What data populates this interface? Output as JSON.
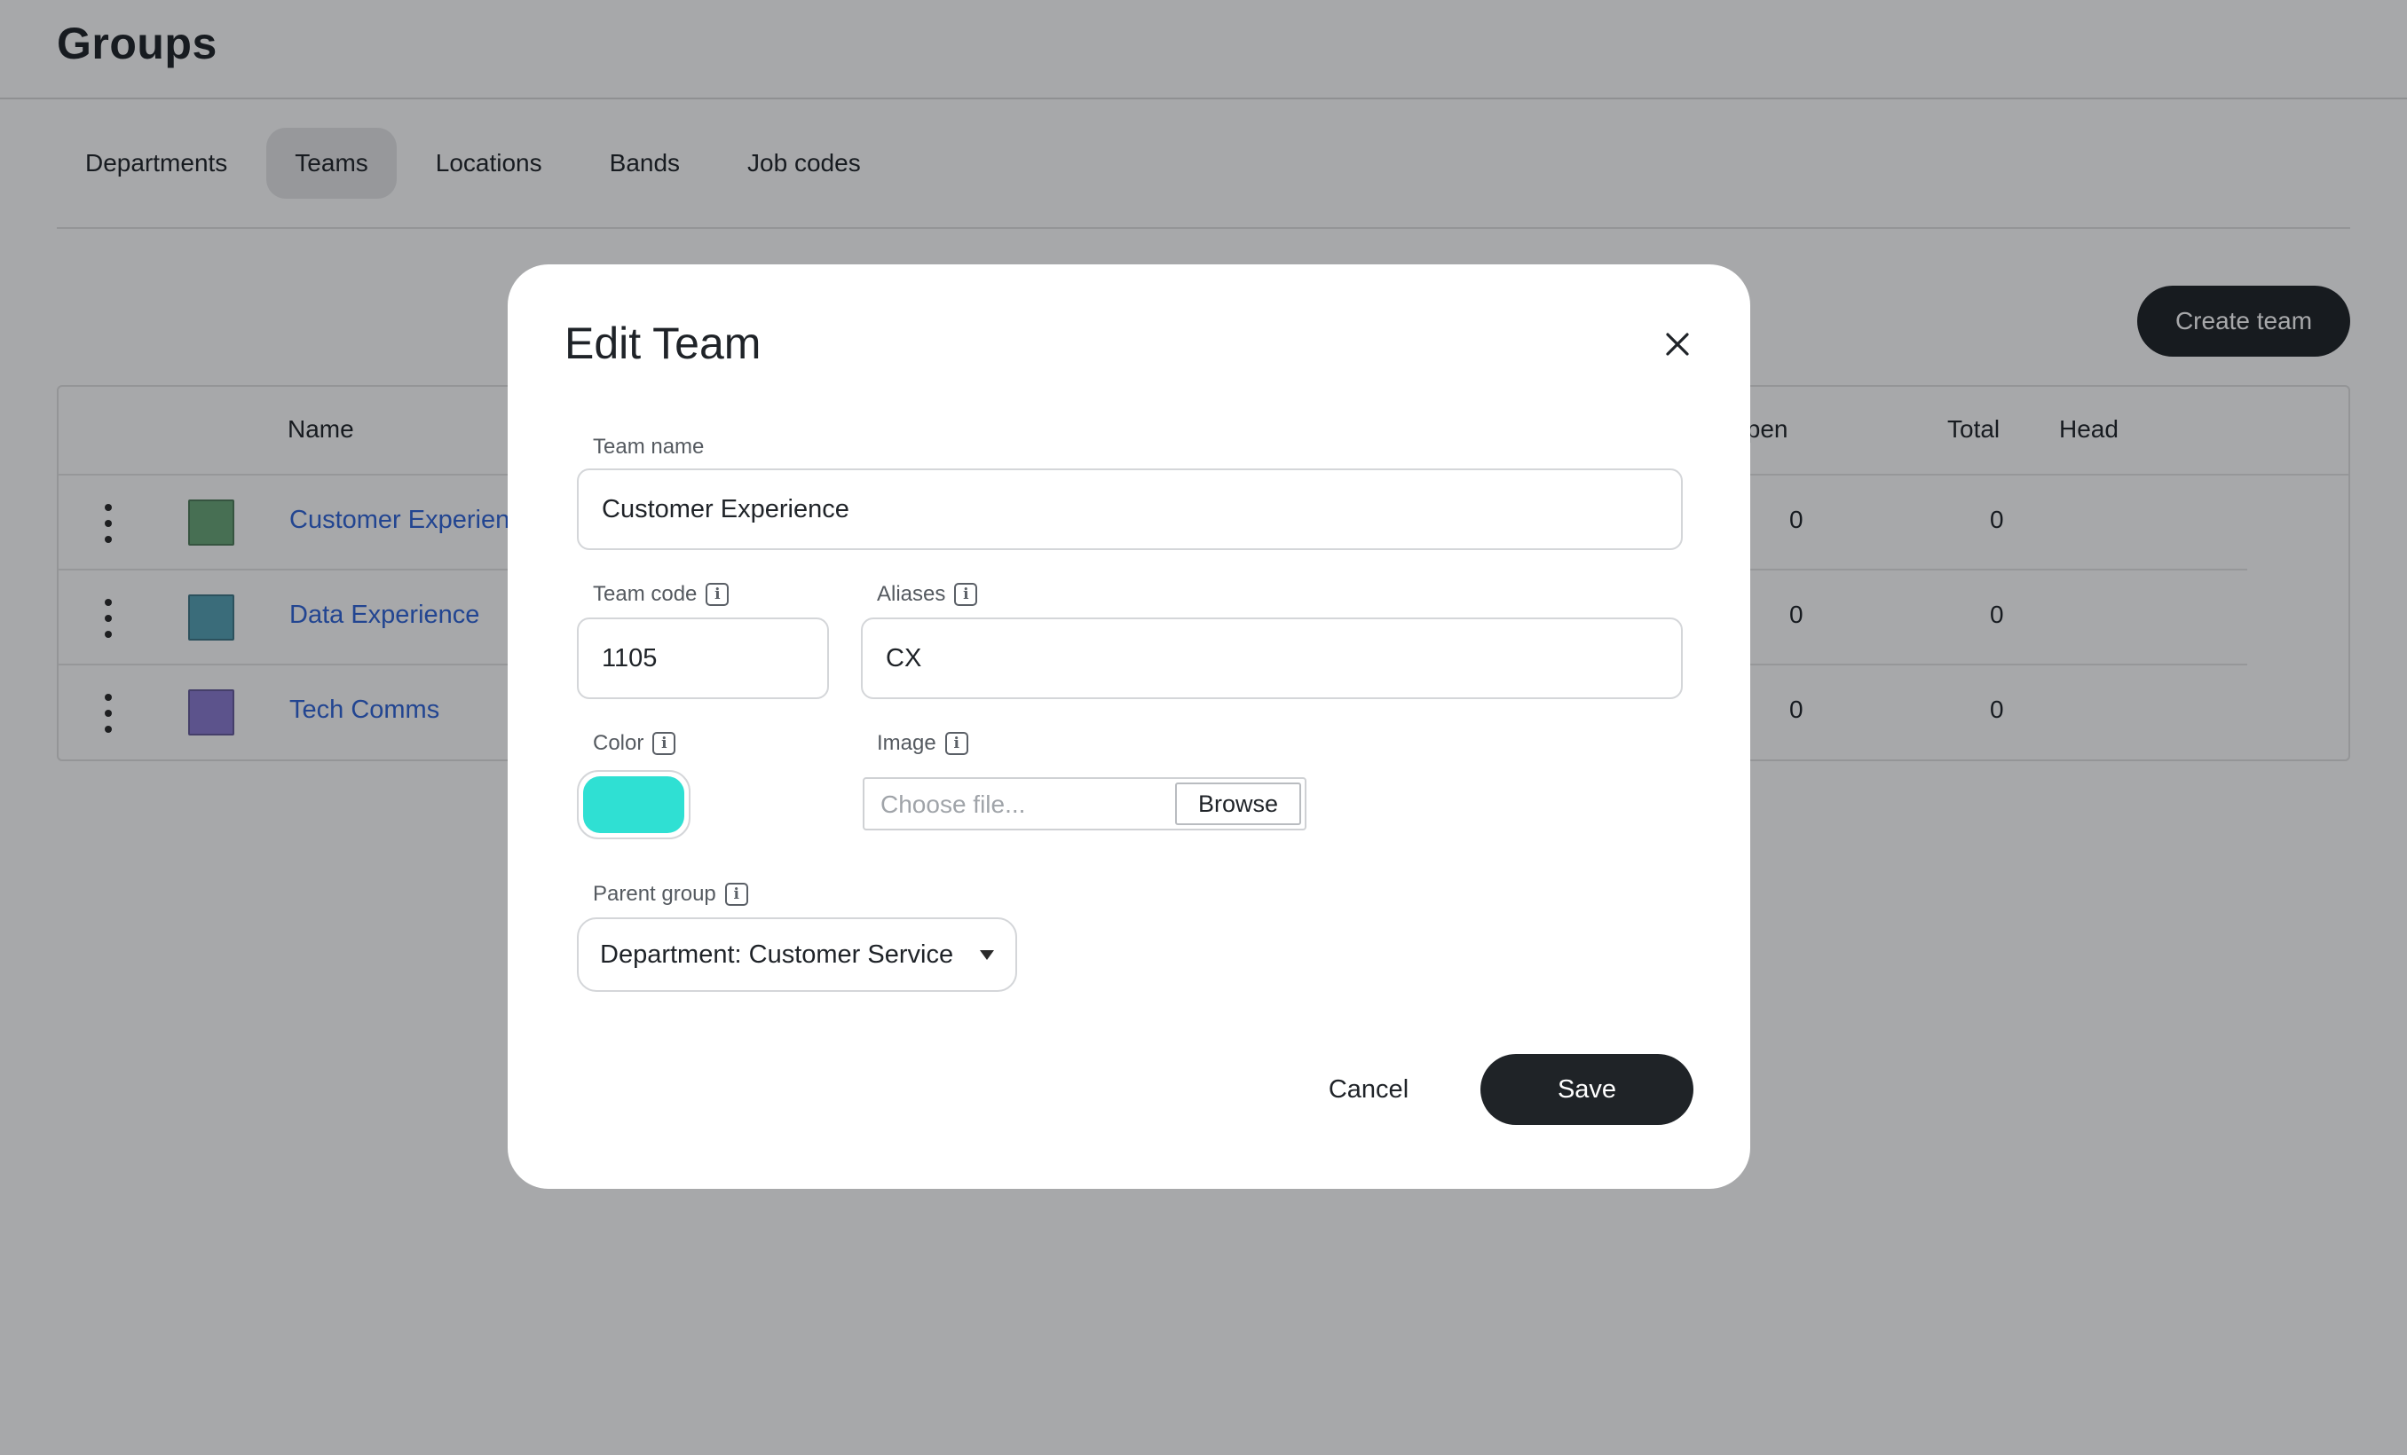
{
  "page": {
    "title": "Groups",
    "tabs": [
      {
        "label": "Departments",
        "active": false
      },
      {
        "label": "Teams",
        "active": true
      },
      {
        "label": "Locations",
        "active": false
      },
      {
        "label": "Bands",
        "active": false
      },
      {
        "label": "Job codes",
        "active": false
      }
    ],
    "create_button": "Create team"
  },
  "table": {
    "columns": {
      "name": "Name",
      "open": "Open",
      "total": "Total",
      "head": "Head"
    },
    "rows": [
      {
        "name": "Customer Experience",
        "color": "#6aa678",
        "open": "0",
        "total": "0",
        "head": ""
      },
      {
        "name": "Data Experience",
        "color": "#55a1b4",
        "open": "0",
        "total": "0",
        "head": ""
      },
      {
        "name": "Tech Comms",
        "color": "#8a7ad0",
        "open": "0",
        "total": "0",
        "head": ""
      }
    ]
  },
  "modal": {
    "title": "Edit Team",
    "close_icon": "close-icon",
    "team_name": {
      "label": "Team name",
      "value": "Customer Experience"
    },
    "team_code": {
      "label": "Team code",
      "value": "1105"
    },
    "aliases": {
      "label": "Aliases",
      "value": "CX"
    },
    "color": {
      "label": "Color",
      "value": "#2fe0d3"
    },
    "image": {
      "label": "Image",
      "placeholder": "Choose file...",
      "browse_label": "Browse"
    },
    "parent_group": {
      "label": "Parent group",
      "value": "Department: Customer Service"
    },
    "cancel_label": "Cancel",
    "save_label": "Save"
  },
  "colors": {
    "primary_button": "#1f2327",
    "link": "#2f64d8"
  }
}
